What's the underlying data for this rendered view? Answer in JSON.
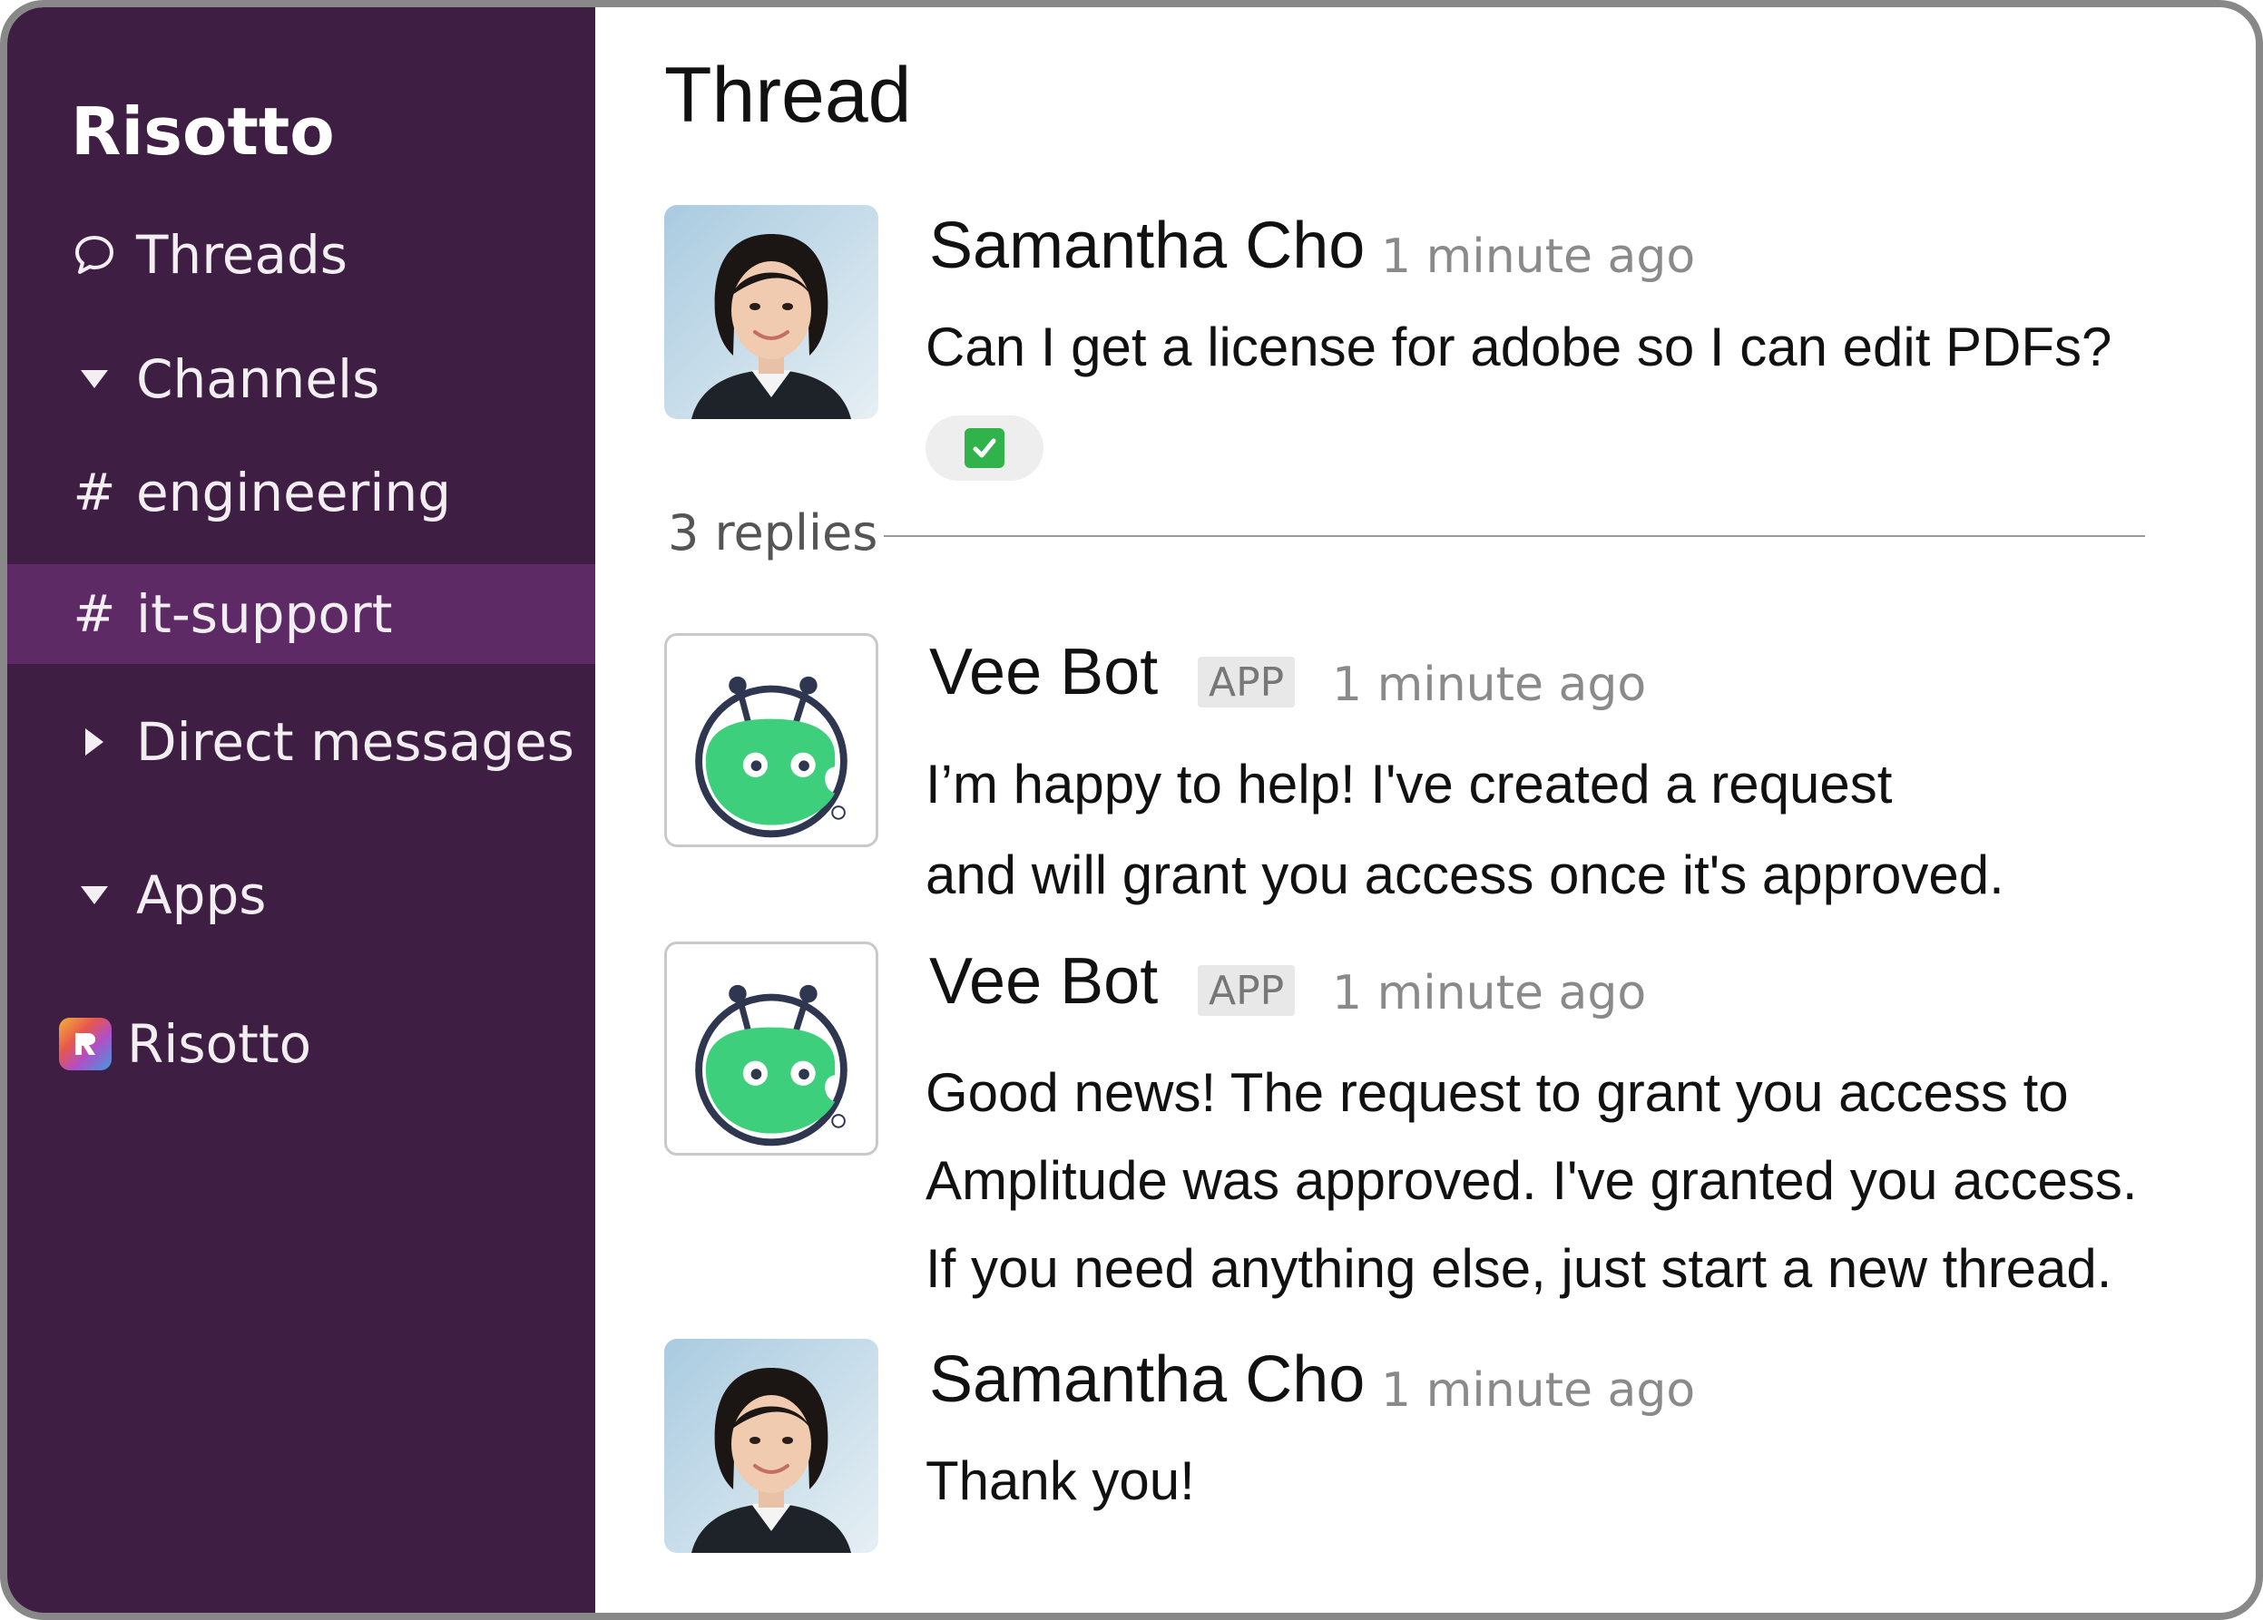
{
  "sidebar": {
    "workspace": "Risotto",
    "items": [
      {
        "label": "Threads"
      },
      {
        "label": "Channels"
      },
      {
        "label": "engineering",
        "prefix": "#"
      },
      {
        "label": "it-support",
        "prefix": "#"
      },
      {
        "label": "Direct messages"
      },
      {
        "label": "Apps"
      },
      {
        "label": "Risotto"
      }
    ]
  },
  "thread": {
    "title": "Thread",
    "replies_label": "3 replies",
    "messages": [
      {
        "author": "Samantha Cho",
        "time": "1 minute ago",
        "lines": [
          "Can I get a license for adobe so I can edit PDFs?"
        ],
        "reaction": "check-mark-reaction"
      },
      {
        "author": "Vee Bot",
        "badge": "APP",
        "time": "1 minute ago",
        "lines": [
          "I’m happy to help! I've created a request",
          "and will grant you access once it's approved."
        ]
      },
      {
        "author": "Vee Bot",
        "badge": "APP",
        "time": "1 minute ago",
        "lines": [
          "Good news! The request to grant you access to",
          "Amplitude was approved. I've granted you access.",
          "If you need anything else, just start a new thread."
        ]
      },
      {
        "author": "Samantha Cho",
        "time": "1 minute ago",
        "lines": [
          "Thank you!"
        ]
      }
    ]
  },
  "colors": {
    "sidebar_bg": "#3f1e44",
    "sidebar_active": "#5e2a66",
    "bot_green": "#3ecf7c",
    "reaction_green": "#2fb34a"
  }
}
